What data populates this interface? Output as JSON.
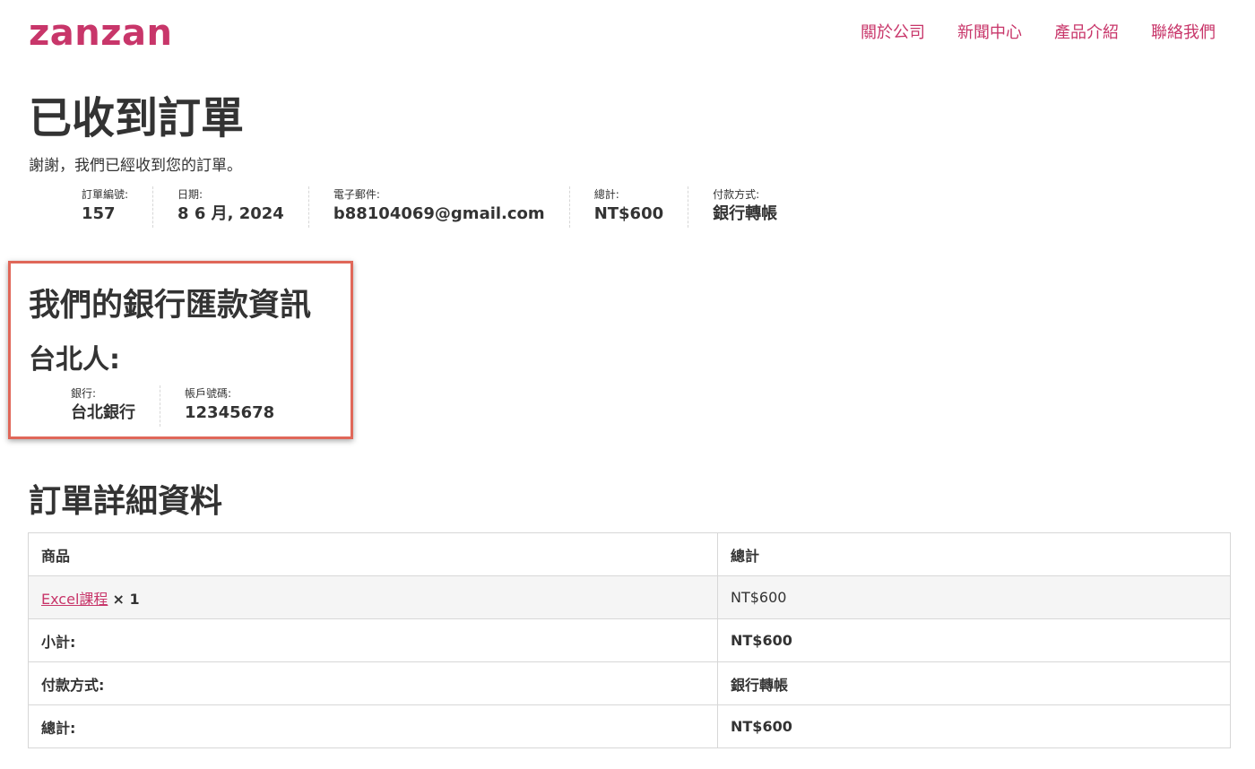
{
  "brand": {
    "logo": "zanzan",
    "accent": "#c8366a"
  },
  "nav": {
    "items": [
      {
        "label": "關於公司"
      },
      {
        "label": "新聞中心"
      },
      {
        "label": "產品介紹"
      },
      {
        "label": "聯絡我們"
      }
    ]
  },
  "page": {
    "title": "已收到訂單",
    "thanks": "謝謝，我們已經收到您的訂單。"
  },
  "overview": {
    "order_number": {
      "label": "訂單編號:",
      "value": "157"
    },
    "date": {
      "label": "日期:",
      "value": "8 6 月, 2024"
    },
    "email": {
      "label": "電子郵件:",
      "value": "b88104069@gmail.com"
    },
    "total": {
      "label": "總計:",
      "value": "NT$600"
    },
    "payment": {
      "label": "付款方式:",
      "value": "銀行轉帳"
    }
  },
  "bank": {
    "title": "我們的銀行匯款資訊",
    "account_name": "台北人:",
    "bank": {
      "label": "銀行:",
      "value": "台北銀行"
    },
    "account_number": {
      "label": "帳戶號碼:",
      "value": "12345678"
    },
    "highlight_color": "#e06759"
  },
  "order_details": {
    "title": "訂單詳細資料",
    "headers": {
      "product": "商品",
      "total": "總計"
    },
    "item": {
      "name": "Excel課程",
      "qty": "× 1",
      "total": "NT$600"
    },
    "subtotal": {
      "label": "小計:",
      "value": "NT$600"
    },
    "payment": {
      "label": "付款方式:",
      "value": "銀行轉帳"
    },
    "total": {
      "label": "總計:",
      "value": "NT$600"
    }
  }
}
